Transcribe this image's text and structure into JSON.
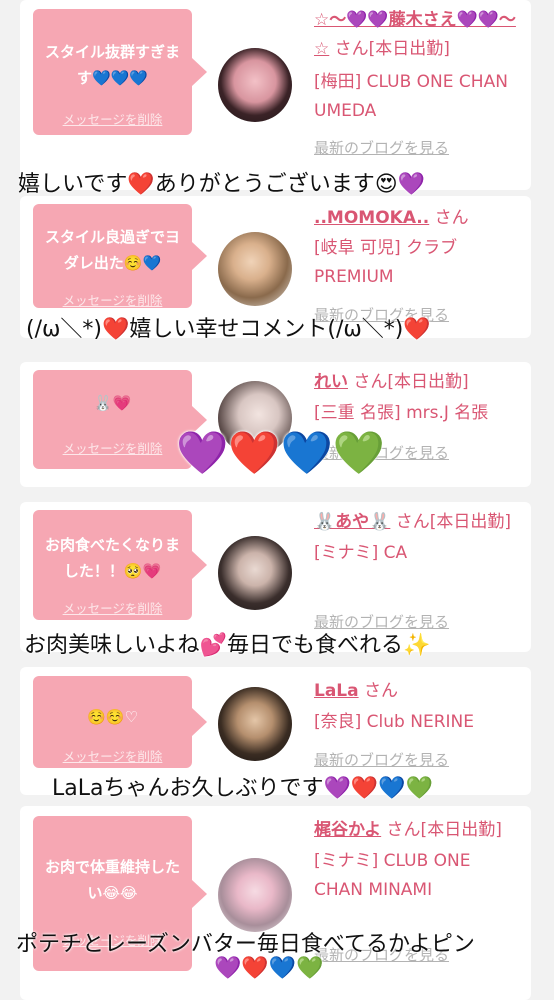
{
  "colors": {
    "bubble": "#f6a7b3",
    "name": "#d95673",
    "link": "#b3b3b3",
    "background": "#f2f2f2"
  },
  "cards": [
    {
      "bubble": "スタイル抜群すぎます💙💙💙",
      "delete": "メッセージを削除",
      "name": "☆〜💜💜藤木さえ💜💜〜☆",
      "suffix": " さん[本日出勤]",
      "shop": "[梅田] CLUB ONE CHAN UMEDA",
      "blog": "最新のブログを見る"
    },
    {
      "bubble": "スタイル良過ぎでヨダレ出た☺️💙",
      "delete": "メッセージを削除",
      "name": "..MOMOKA..",
      "suffix": " さん",
      "shop": "[岐阜 可児] クラブPREMIUM",
      "blog": "最新のブログを見る"
    },
    {
      "bubble": "🐰💗",
      "delete": "メッセージを削除",
      "name": "れい",
      "suffix": " さん[本日出勤]",
      "shop": "[三重 名張] mrs.J 名張",
      "blog": "最新のブログを見る"
    },
    {
      "bubble": "お肉食べたくなりました！！🥺💗",
      "delete": "メッセージを削除",
      "name": "🐰あや🐰",
      "suffix": " さん[本日出勤]",
      "shop": "[ミナミ] CA",
      "blog": "最新のブログを見る"
    },
    {
      "bubble": "☺️☺️♡",
      "delete": "メッセージを削除",
      "name": "LaLa",
      "suffix": " さん",
      "shop": "[奈良] Club NERINE",
      "blog": "最新のブログを見る"
    },
    {
      "bubble": "お肉で体重維持したい😂😂",
      "delete": "メッセージを削除",
      "name": "梶谷かよ",
      "suffix": " さん[本日出勤]",
      "shop": "[ミナミ] CLUB ONE CHAN MINAMI",
      "blog": "最新のブログを見る"
    }
  ],
  "overlays": {
    "o1": "嬉しいです❤️ありがとうございます😍💜",
    "o2": "(/ω＼*)❤️嬉しい幸せコメント(/ω＼*)❤️",
    "o3": "💜❤️💙💚",
    "o4": "お肉美味しいよね💕毎日でも食べれる✨",
    "o5": "LaLaちゃんお久しぶりです💜❤️💙💚",
    "o6": "ポテチとレーズンバター毎日食べてるかよピン",
    "o7": "💜❤️💙💚"
  }
}
